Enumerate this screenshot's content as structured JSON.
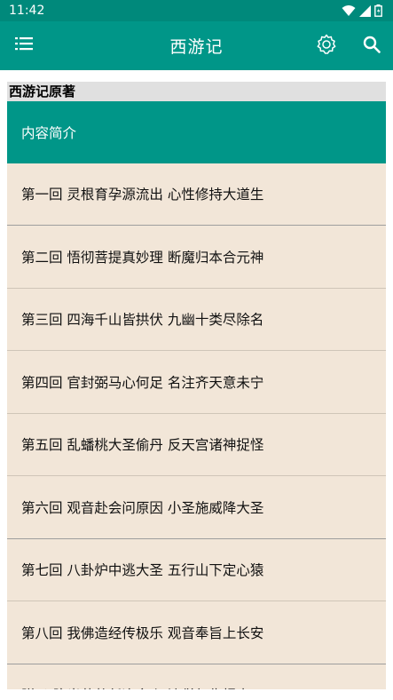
{
  "status_bar": {
    "time": "11:42",
    "icons": [
      "wifi-icon",
      "signal-icon",
      "battery-icon"
    ]
  },
  "app_bar": {
    "title": "西游记",
    "icons": [
      "menu-icon",
      "settings-icon",
      "search-icon"
    ]
  },
  "colors": {
    "primary": "#009688",
    "status": "#00897b",
    "item_bg": "#f2e6d8",
    "header_bg": "#e0e0e0"
  },
  "section": {
    "title": "西游记原著"
  },
  "chapters": [
    {
      "label": "内容简介",
      "selected": true
    },
    {
      "label": "第一回 灵根育孕源流出 心性修持大道生"
    },
    {
      "label": "第二回 悟彻菩提真妙理 断魔归本合元神"
    },
    {
      "label": "第三回 四海千山皆拱伏 九幽十类尽除名"
    },
    {
      "label": "第四回 官封弼马心何足 名注齐天意未宁"
    },
    {
      "label": "第五回 乱蟠桃大圣偷丹 反天宫诸神捉怪"
    },
    {
      "label": "第六回 观音赴会问原因 小圣施威降大圣"
    },
    {
      "label": "第七回 八卦炉中逃大圣 五行山下定心猿"
    },
    {
      "label": "第八回 我佛造经传极乐 观音奉旨上长安"
    },
    {
      "label": "附录 陈光蕊赴任逢灾 江流僧复仇报本"
    }
  ]
}
